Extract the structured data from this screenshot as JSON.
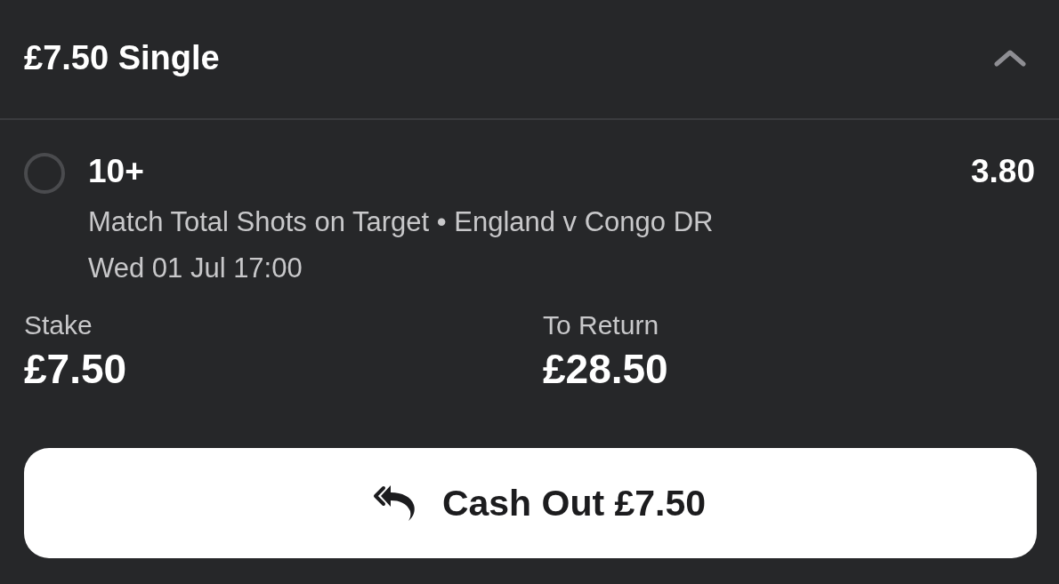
{
  "bet_header": {
    "title": "£7.50 Single",
    "expanded": true
  },
  "selection": {
    "name": "10+",
    "odds": "3.80",
    "market": "Match Total Shots on Target • England v Congo DR",
    "start_time": "Wed 01 Jul 17:00"
  },
  "stake": {
    "label": "Stake",
    "value": "£7.50"
  },
  "returns": {
    "label": "To Return",
    "value": "£28.50"
  },
  "cash_out_button": {
    "label": "Cash Out £7.50"
  }
}
